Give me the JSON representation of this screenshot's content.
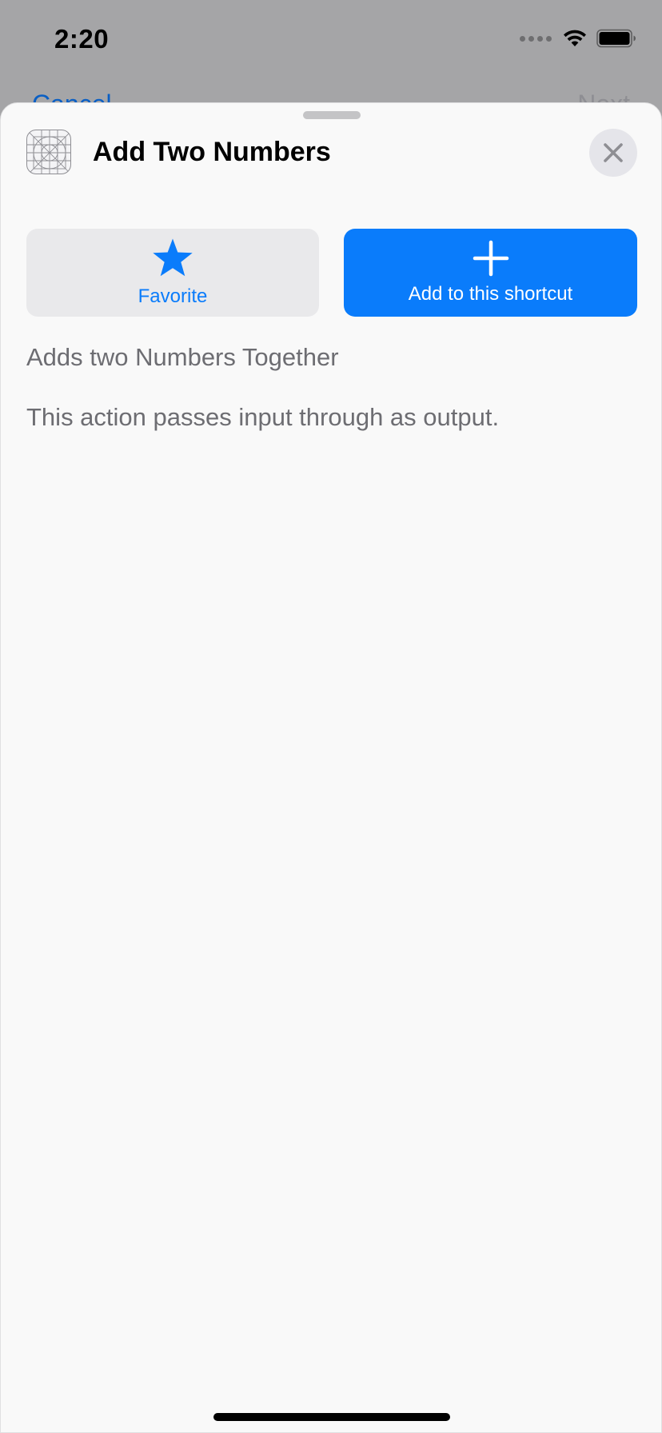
{
  "status_bar": {
    "time": "2:20",
    "icons": [
      "signal-dots-icon",
      "wifi-icon",
      "battery-icon"
    ]
  },
  "background_nav": {
    "cancel_label": "Cancel",
    "next_label": "Next"
  },
  "sheet": {
    "title": "Add Two Numbers",
    "app_icon": "action-grid-icon",
    "close_icon": "close-icon",
    "favorite_button": {
      "label": "Favorite",
      "icon": "star-icon"
    },
    "add_button": {
      "label": "Add to this shortcut",
      "icon": "plus-icon"
    },
    "description": "Adds two Numbers Together",
    "io_note": "This action passes input through as output."
  },
  "colors": {
    "accent": "#0A7CFB",
    "sheet_background": "#F9F9F9",
    "dimmed_background": "#A5A5A7",
    "secondary_text": "#6D6D72",
    "favorite_button_bg": "#E9E9EB"
  }
}
